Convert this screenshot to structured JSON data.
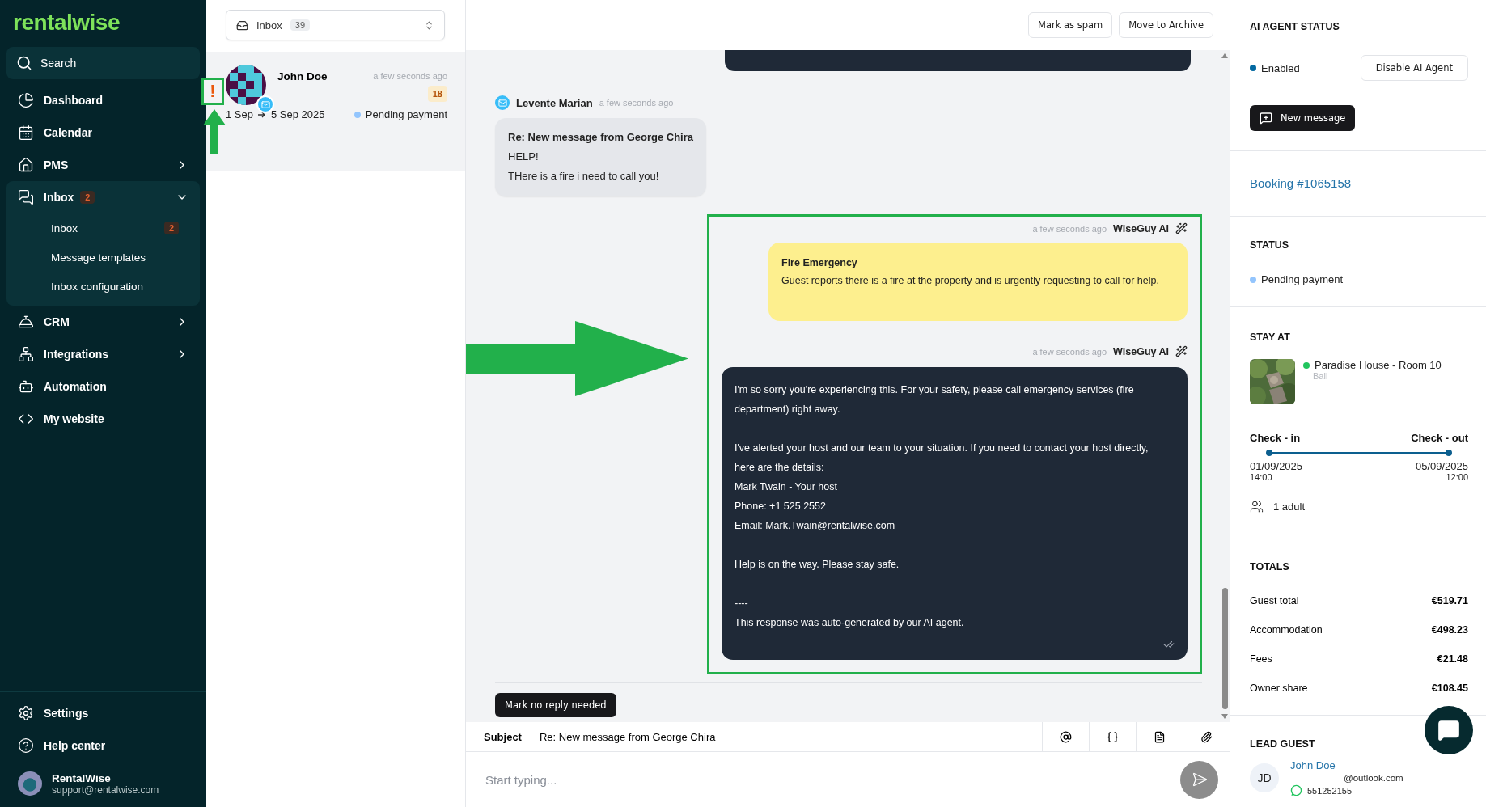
{
  "sidebar": {
    "logo": "rentalwise",
    "search": "Search",
    "items": [
      {
        "label": "Dashboard"
      },
      {
        "label": "Calendar"
      },
      {
        "label": "PMS",
        "expanded": false
      },
      {
        "label": "Inbox",
        "badge": "2",
        "expanded": true,
        "children": [
          {
            "label": "Inbox",
            "badge": "2"
          },
          {
            "label": "Message templates"
          },
          {
            "label": "Inbox configuration"
          }
        ]
      },
      {
        "label": "CRM",
        "expanded": false
      },
      {
        "label": "Integrations",
        "expanded": false
      },
      {
        "label": "Automation"
      },
      {
        "label": "My website"
      }
    ],
    "footer": [
      {
        "label": "Settings"
      },
      {
        "label": "Help center"
      }
    ],
    "user": {
      "name": "RentalWise",
      "email": "support@rentalwise.com"
    }
  },
  "inbox_select": {
    "label": "Inbox",
    "count": "39"
  },
  "conversations": [
    {
      "name": "John Doe",
      "time": "a few seconds ago",
      "unread": "18",
      "alert": "!",
      "from": "1 Sep",
      "to": "5 Sep 2025",
      "status": {
        "label": "Pending payment",
        "color": "#93c5fd"
      },
      "selected": true
    }
  ],
  "toolbar": {
    "buttons": [
      "Mark as spam",
      "Move to Archive"
    ]
  },
  "messages": [
    {
      "kind": "partial"
    },
    {
      "kind": "incoming",
      "sender": "Levente Marian",
      "time": "a few seconds ago",
      "subject": "Re: New message from George Chira",
      "lines": [
        "HELP!",
        "THere is a fire i need to call you!"
      ]
    },
    {
      "kind": "ai_alert",
      "sender": "WiseGuy AI",
      "time": "a few seconds ago",
      "title": "Fire Emergency",
      "lines": [
        "Guest reports there is a fire at the property and is urgently requesting to call for help."
      ]
    },
    {
      "kind": "ai_reply",
      "sender": "WiseGuy AI",
      "time": "a few seconds ago",
      "paragraphs": [
        [
          "I'm so sorry you're experiencing this. For your safety, please call emergency services (fire department) right away."
        ],
        [
          "I've alerted your host and our team to your situation. If you need to contact your host directly, here are the details:",
          "Mark Twain - Your host",
          "Phone: +1 525 2552",
          "Email: Mark.Twain@rentalwise.com"
        ],
        [
          "Help is on the way. Please stay safe."
        ],
        [
          "----",
          "This response was auto-generated by our AI agent."
        ]
      ]
    }
  ],
  "no_reply_button": "Mark no reply needed",
  "composer": {
    "subject_label": "Subject",
    "subject": "Re: New message from George Chira",
    "placeholder": "Start typing..."
  },
  "details": {
    "ai_agent": {
      "title": "AI AGENT STATUS",
      "status": {
        "label": "Enabled",
        "color": "#0369a1"
      },
      "toggle_button": "Disable AI Agent",
      "new_message": "New message"
    },
    "booking": "Booking #1065158",
    "status": {
      "title": "STATUS",
      "value": "Pending payment",
      "color": "#93c5fd"
    },
    "stay": {
      "title": "STAY AT",
      "property": {
        "name": "Paradise House - Room 10",
        "color": "#22c55e"
      },
      "location": "Bali",
      "checkin_label": "Check - in",
      "checkout_label": "Check - out",
      "checkin_date": "01/09/2025",
      "checkin_time": "14:00",
      "checkout_date": "05/09/2025",
      "checkout_time": "12:00",
      "guests": "1 adult"
    },
    "totals": {
      "title": "TOTALS",
      "rows": [
        {
          "label": "Guest total",
          "value": "€519.71"
        },
        {
          "label": "Accommodation",
          "value": "€498.23"
        },
        {
          "label": "Fees",
          "value": "€21.48"
        },
        {
          "label": "Owner share",
          "value": "€108.45"
        }
      ]
    },
    "lead_guest": {
      "title": "LEAD GUEST",
      "initials": "JD",
      "name": "John Doe",
      "email": "@outlook.com",
      "phone": "551252155"
    }
  }
}
